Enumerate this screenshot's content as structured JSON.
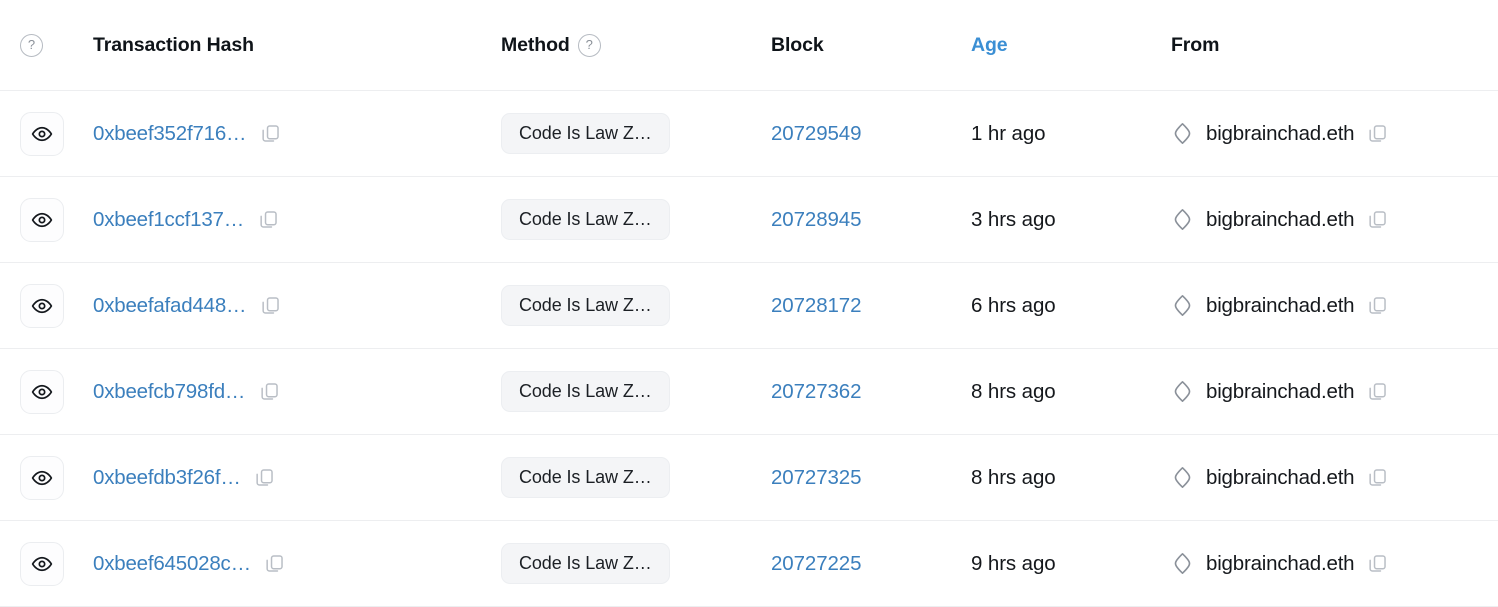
{
  "table": {
    "columns": {
      "eye": {
        "label": "",
        "help_icon": "help-circle-icon"
      },
      "hash": {
        "label": "Transaction Hash"
      },
      "method": {
        "label": "Method",
        "help_icon": "help-circle-icon"
      },
      "block": {
        "label": "Block"
      },
      "age": {
        "label": "Age",
        "sorted": true,
        "color": "#3b8fd4"
      },
      "from": {
        "label": "From"
      }
    },
    "help_glyph": "?",
    "rows": [
      {
        "hash": "0xbeef352f716…",
        "method": "Code Is Law Z…",
        "block": "20729549",
        "age": "1 hr ago",
        "from": "bigbrainchad.eth"
      },
      {
        "hash": "0xbeef1ccf137…",
        "method": "Code Is Law Z…",
        "block": "20728945",
        "age": "3 hrs ago",
        "from": "bigbrainchad.eth"
      },
      {
        "hash": "0xbeefafad448…",
        "method": "Code Is Law Z…",
        "block": "20728172",
        "age": "6 hrs ago",
        "from": "bigbrainchad.eth"
      },
      {
        "hash": "0xbeefcb798fd…",
        "method": "Code Is Law Z…",
        "block": "20727362",
        "age": "8 hrs ago",
        "from": "bigbrainchad.eth"
      },
      {
        "hash": "0xbeefdb3f26f…",
        "method": "Code Is Law Z…",
        "block": "20727325",
        "age": "8 hrs ago",
        "from": "bigbrainchad.eth"
      },
      {
        "hash": "0xbeef645028c…",
        "method": "Code Is Law Z…",
        "block": "20727225",
        "age": "9 hrs ago",
        "from": "bigbrainchad.eth"
      }
    ]
  },
  "colors": {
    "link": "#3b7fbd",
    "sorted_header": "#3b8fd4",
    "text": "#15181c",
    "border": "#edeef0",
    "badge_bg": "#f4f5f7"
  }
}
